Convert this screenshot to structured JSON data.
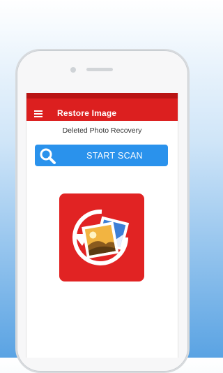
{
  "appbar": {
    "title": "Restore Image",
    "menu_icon": "hamburger-menu-icon",
    "color": "#dc1f1f"
  },
  "main": {
    "subtitle": "Deleted Photo Recovery",
    "scan_button": {
      "label": "START SCAN",
      "icon": "search-icon",
      "color": "#2a92ec"
    },
    "logo": {
      "icon": "photo-restore-icon",
      "color": "#e12323"
    }
  },
  "background": {
    "top_color": "#ffffff",
    "bottom_color": "#5aa3e3"
  }
}
